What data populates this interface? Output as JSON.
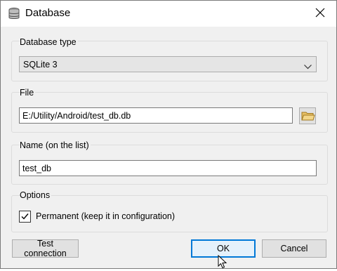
{
  "window": {
    "title": "Database"
  },
  "database_type": {
    "label": "Database type",
    "selected": "SQLite 3"
  },
  "file": {
    "label": "File",
    "path": "E:/Utility/Android/test_db.db"
  },
  "name": {
    "label": "Name (on the list)",
    "value": "test_db"
  },
  "options": {
    "label": "Options",
    "permanent_label": "Permanent (keep it in configuration)",
    "permanent_checked": true
  },
  "buttons": {
    "test_connection": "Test connection",
    "ok": "OK",
    "cancel": "Cancel"
  }
}
